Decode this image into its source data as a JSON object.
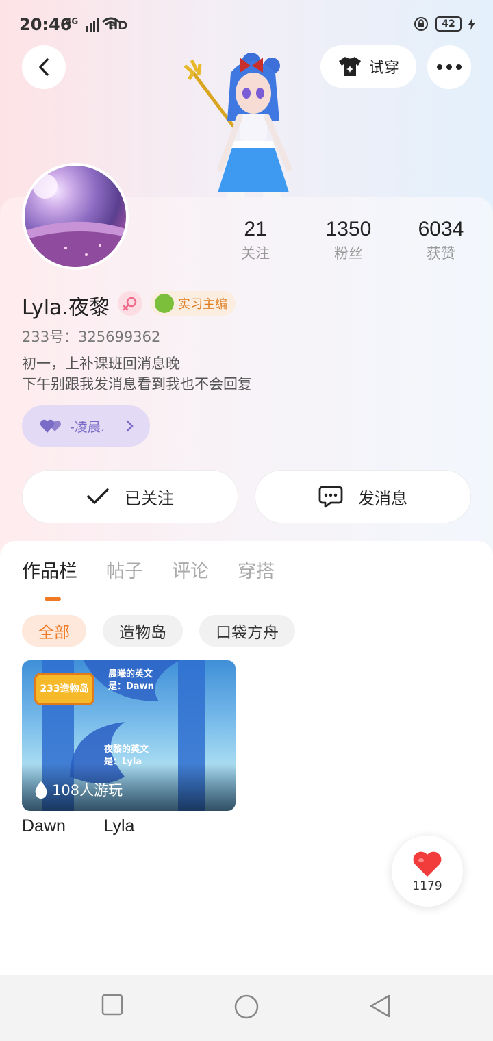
{
  "status_bar": {
    "time": "20:46",
    "signal_label": "4G",
    "hd_label": "HD",
    "battery": "42"
  },
  "header": {
    "try_on_label": "试穿"
  },
  "profile": {
    "username": "Lyla.夜黎",
    "role_badge": "实习主编",
    "uid": "233号：325699362",
    "bio_line1": "初一，上补课班回消息晚",
    "bio_line2": "下午别跟我发消息看到我也不会回复",
    "friend_label": "-凌晨.",
    "stats": [
      {
        "num": "21",
        "label": "关注"
      },
      {
        "num": "1350",
        "label": "粉丝"
      },
      {
        "num": "6034",
        "label": "获赞"
      }
    ]
  },
  "actions": {
    "follow_label": "已关注",
    "message_label": "发消息"
  },
  "tabs": [
    "作品栏",
    "帖子",
    "评论",
    "穿搭"
  ],
  "chips": [
    "全部",
    "造物岛",
    "口袋方舟"
  ],
  "work": {
    "logo_text": "233造物岛",
    "art_text_1": "晨曦的英文\n是：Dawn",
    "art_text_2": "夜黎的英文\n是：Lyla",
    "play_count": "108人游玩",
    "title": "Dawn        Lyla"
  },
  "like": {
    "count": "1179"
  },
  "colors": {
    "accent": "#f07a24",
    "friend_purple": "#7a6bc6",
    "heart_red": "#f23b3b"
  }
}
